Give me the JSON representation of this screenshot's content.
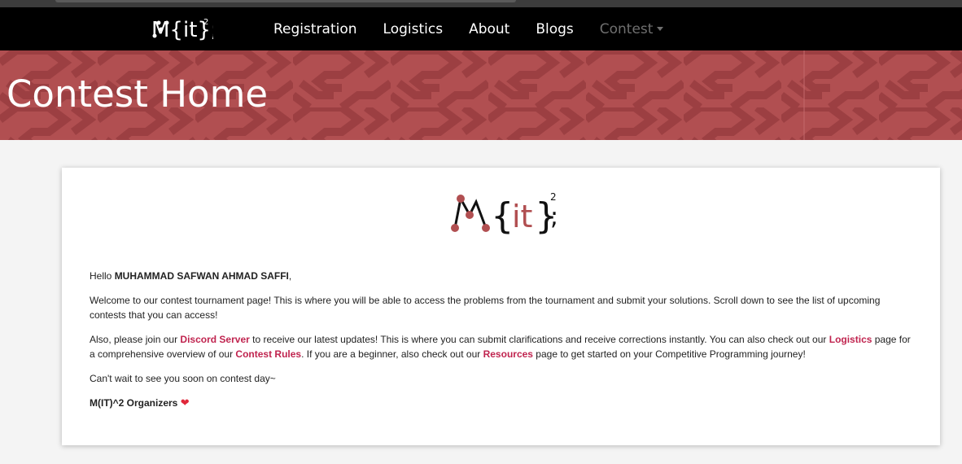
{
  "nav": {
    "brand": "M{it}²",
    "links": [
      "Registration",
      "Logistics",
      "About",
      "Blogs"
    ],
    "dropdown_label": "Contest"
  },
  "hero": {
    "title": "Contest Home"
  },
  "card": {
    "greeting_prefix": "Hello ",
    "user_name": "MUHAMMAD SAFWAN AHMAD SAFFI",
    "greeting_suffix": ",",
    "welcome": "Welcome to our contest tournament page! This is where you will be able to access the problems from the tournament and submit your solutions. Scroll down to see the list of upcoming contests that you can access!",
    "join": {
      "t1": "Also, please join our ",
      "discord": "Discord Server",
      "t2": " to receive our latest updates! This is where you can submit clarifications and receive corrections instantly. You can also check out our ",
      "logistics": "Logistics",
      "t3": " page for a comprehensive overview of our ",
      "rules": "Contest Rules",
      "t4": ". If you are a beginner, also check out our ",
      "resources": "Resources",
      "t5": " page to get started on your Competitive Programming journey!"
    },
    "closing": "Can't wait to see you soon on contest day~",
    "signature": "M(IT)^2 Organizers",
    "heart": "❤"
  },
  "colors": {
    "accent": "#b14f51",
    "link": "#c0244f",
    "nav_bg": "#000000"
  },
  "icons": {
    "brand_logo": "mit2-logo",
    "dropdown": "caret-down-icon",
    "heart": "heart-icon"
  }
}
